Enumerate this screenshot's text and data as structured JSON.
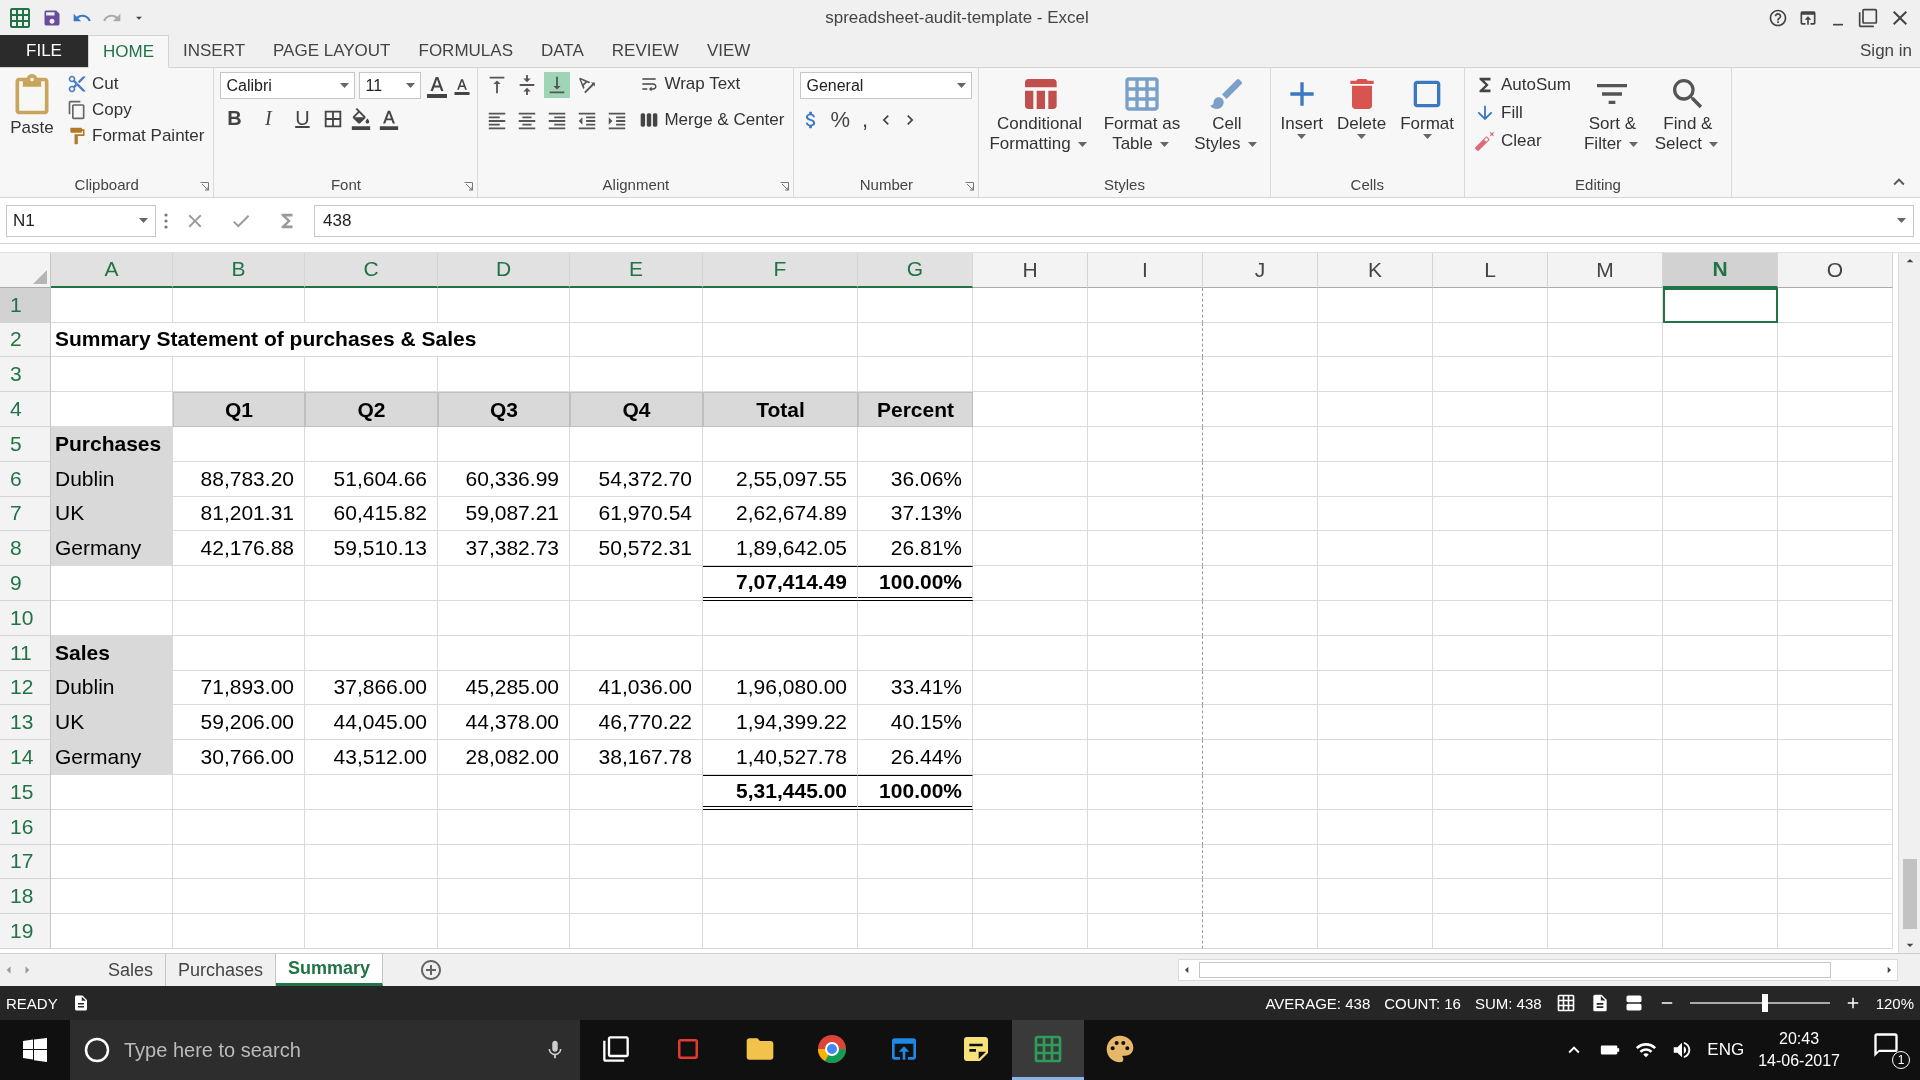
{
  "window": {
    "title": "spreadsheet-audit-template - Excel",
    "sign_in": "Sign in"
  },
  "menu_tabs": [
    {
      "label": "FILE",
      "kind": "file",
      "selected": false
    },
    {
      "label": "HOME",
      "kind": "tab",
      "selected": true
    },
    {
      "label": "INSERT",
      "kind": "tab",
      "selected": false
    },
    {
      "label": "PAGE LAYOUT",
      "kind": "tab",
      "selected": false
    },
    {
      "label": "FORMULAS",
      "kind": "tab",
      "selected": false
    },
    {
      "label": "DATA",
      "kind": "tab",
      "selected": false
    },
    {
      "label": "REVIEW",
      "kind": "tab",
      "selected": false
    },
    {
      "label": "VIEW",
      "kind": "tab",
      "selected": false
    }
  ],
  "ribbon": {
    "groups": [
      {
        "kind": "clipboard",
        "label": "Clipboard",
        "large": "Paste",
        "small": [
          "Cut",
          "Copy",
          "Format Painter"
        ]
      },
      {
        "kind": "font",
        "label": "Font",
        "font": "Calibri",
        "size": "11",
        "format_buttons": [
          "B",
          "I",
          "U"
        ]
      },
      {
        "kind": "alignment",
        "label": "Alignment",
        "small": [
          "Wrap Text",
          "Merge & Center"
        ]
      },
      {
        "kind": "number",
        "label": "Number",
        "format": "General",
        "symbols": [
          "%",
          ","
        ]
      },
      {
        "kind": "styles",
        "label": "Styles",
        "large": [
          [
            "Conditional",
            "Formatting"
          ],
          [
            "Format as",
            "Table"
          ],
          [
            "Cell",
            "Styles"
          ]
        ]
      },
      {
        "kind": "cells",
        "label": "Cells",
        "large": [
          "Insert",
          "Delete",
          "Format"
        ]
      },
      {
        "kind": "editing",
        "label": "Editing",
        "small": [
          "AutoSum",
          "Fill",
          "Clear"
        ],
        "large": [
          [
            "Sort &",
            "Filter"
          ],
          [
            "Find &",
            "Select"
          ]
        ]
      }
    ]
  },
  "formula_bar": {
    "name_box": "N1",
    "value": "438"
  },
  "sheet": {
    "columns": [
      {
        "letter": "A",
        "selected": false
      },
      {
        "letter": "B",
        "selected": false
      },
      {
        "letter": "C",
        "selected": false
      },
      {
        "letter": "D",
        "selected": false
      },
      {
        "letter": "E",
        "selected": false
      },
      {
        "letter": "F",
        "selected": false
      },
      {
        "letter": "G",
        "selected": false
      },
      {
        "letter": "H",
        "selected": false
      },
      {
        "letter": "I",
        "selected": false
      },
      {
        "letter": "J",
        "selected": false
      },
      {
        "letter": "K",
        "selected": false
      },
      {
        "letter": "L",
        "selected": false
      },
      {
        "letter": "M",
        "selected": false
      },
      {
        "letter": "N",
        "selected": true
      },
      {
        "letter": "O",
        "selected": false
      }
    ],
    "rows": [
      {
        "number": "1",
        "selected": true
      },
      {
        "number": "2",
        "selected": false,
        "cells": [
          {
            "kind": "title",
            "text": "Summary Statement of purchases & Sales"
          }
        ]
      },
      {
        "number": "3",
        "selected": false
      },
      {
        "number": "4",
        "selected": false,
        "cells": [
          {
            "kind": "blank"
          },
          {
            "kind": "header",
            "text": "Q1"
          },
          {
            "kind": "header",
            "text": "Q2"
          },
          {
            "kind": "header",
            "text": "Q3"
          },
          {
            "kind": "header",
            "text": "Q4"
          },
          {
            "kind": "header",
            "text": "Total"
          },
          {
            "kind": "header",
            "text": "Percent"
          }
        ]
      },
      {
        "number": "5",
        "selected": false,
        "cells": [
          {
            "kind": "section",
            "text": "Purchases"
          }
        ]
      },
      {
        "number": "6",
        "selected": false,
        "cells": [
          {
            "kind": "label",
            "text": "Dublin"
          },
          {
            "kind": "number",
            "text": "88,783.20"
          },
          {
            "kind": "number",
            "text": "51,604.66"
          },
          {
            "kind": "number",
            "text": "60,336.99"
          },
          {
            "kind": "number",
            "text": "54,372.70"
          },
          {
            "kind": "number",
            "text": "2,55,097.55"
          },
          {
            "kind": "number",
            "text": "36.06%"
          }
        ]
      },
      {
        "number": "7",
        "selected": false,
        "cells": [
          {
            "kind": "label",
            "text": "UK"
          },
          {
            "kind": "number",
            "text": "81,201.31"
          },
          {
            "kind": "number",
            "text": "60,415.82"
          },
          {
            "kind": "number",
            "text": "59,087.21"
          },
          {
            "kind": "number",
            "text": "61,970.54"
          },
          {
            "kind": "number",
            "text": "2,62,674.89"
          },
          {
            "kind": "number",
            "text": "37.13%"
          }
        ]
      },
      {
        "number": "8",
        "selected": false,
        "cells": [
          {
            "kind": "label",
            "text": "Germany"
          },
          {
            "kind": "number",
            "text": "42,176.88"
          },
          {
            "kind": "number",
            "text": "59,510.13"
          },
          {
            "kind": "number",
            "text": "37,382.73"
          },
          {
            "kind": "number",
            "text": "50,572.31"
          },
          {
            "kind": "number",
            "text": "1,89,642.05"
          },
          {
            "kind": "number",
            "text": "26.81%"
          }
        ]
      },
      {
        "number": "9",
        "selected": false,
        "cells": [
          {
            "kind": "blank"
          },
          {
            "kind": "blank"
          },
          {
            "kind": "blank"
          },
          {
            "kind": "blank"
          },
          {
            "kind": "blank"
          },
          {
            "kind": "total",
            "text": "7,07,414.49"
          },
          {
            "kind": "total",
            "text": "100.00%"
          }
        ]
      },
      {
        "number": "10",
        "selected": false
      },
      {
        "number": "11",
        "selected": false,
        "cells": [
          {
            "kind": "section",
            "text": "Sales"
          }
        ]
      },
      {
        "number": "12",
        "selected": false,
        "cells": [
          {
            "kind": "label",
            "text": "Dublin"
          },
          {
            "kind": "number",
            "text": "71,893.00"
          },
          {
            "kind": "number",
            "text": "37,866.00"
          },
          {
            "kind": "number",
            "text": "45,285.00"
          },
          {
            "kind": "number",
            "text": "41,036.00"
          },
          {
            "kind": "number",
            "text": "1,96,080.00"
          },
          {
            "kind": "number",
            "text": "33.41%"
          }
        ]
      },
      {
        "number": "13",
        "selected": false,
        "cells": [
          {
            "kind": "label",
            "text": "UK"
          },
          {
            "kind": "number",
            "text": "59,206.00"
          },
          {
            "kind": "number",
            "text": "44,045.00"
          },
          {
            "kind": "number",
            "text": "44,378.00"
          },
          {
            "kind": "number",
            "text": "46,770.22"
          },
          {
            "kind": "number",
            "text": "1,94,399.22"
          },
          {
            "kind": "number",
            "text": "40.15%"
          }
        ]
      },
      {
        "number": "14",
        "selected": false,
        "cells": [
          {
            "kind": "label",
            "text": "Germany"
          },
          {
            "kind": "number",
            "text": "30,766.00"
          },
          {
            "kind": "number",
            "text": "43,512.00"
          },
          {
            "kind": "number",
            "text": "28,082.00"
          },
          {
            "kind": "number",
            "text": "38,167.78"
          },
          {
            "kind": "number",
            "text": "1,40,527.78"
          },
          {
            "kind": "number",
            "text": "26.44%"
          }
        ]
      },
      {
        "number": "15",
        "selected": false,
        "cells": [
          {
            "kind": "blank"
          },
          {
            "kind": "blank"
          },
          {
            "kind": "blank"
          },
          {
            "kind": "blank"
          },
          {
            "kind": "blank"
          },
          {
            "kind": "total",
            "text": "5,31,445.00"
          },
          {
            "kind": "total",
            "text": "100.00%"
          }
        ]
      },
      {
        "number": "16",
        "selected": false
      },
      {
        "number": "17",
        "selected": false
      },
      {
        "number": "18",
        "selected": false
      },
      {
        "number": "19",
        "selected": false
      }
    ]
  },
  "sheet_tabs": [
    {
      "label": "Sales",
      "selected": false
    },
    {
      "label": "Purchases",
      "selected": false
    },
    {
      "label": "Summary",
      "selected": true
    }
  ],
  "status_bar": {
    "mode": "READY",
    "stats": [
      "AVERAGE: 438",
      "COUNT: 16",
      "SUM: 438"
    ],
    "zoom": {
      "level": 0.52,
      "reading": "120%"
    }
  },
  "taskbar": {
    "search": {
      "placeholder": "Type here to search"
    },
    "apps": [
      {
        "kind": "task-view",
        "active": false
      },
      {
        "kind": "red-app",
        "active": false
      },
      {
        "kind": "folder",
        "active": false
      },
      {
        "kind": "chrome",
        "active": false
      },
      {
        "kind": "edge",
        "active": false
      },
      {
        "kind": "notes",
        "active": false
      },
      {
        "kind": "excel",
        "active": true
      },
      {
        "kind": "paint",
        "active": false
      }
    ],
    "language": "ENG",
    "time": "20:43",
    "date": "14-06-2017",
    "notifications": "1"
  }
}
